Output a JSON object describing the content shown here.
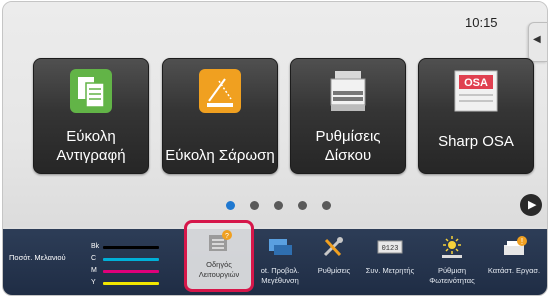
{
  "clock": "10:15",
  "tiles": [
    {
      "label": "Εύκολη Αντιγραφή",
      "icon": "copy-icon"
    },
    {
      "label": "Εύκολη Σάρωση",
      "icon": "scan-icon"
    },
    {
      "label": "Ρυθμίσεις Δίσκου",
      "icon": "tray-settings-icon"
    },
    {
      "label": "Sharp OSA",
      "icon": "sharp-osa-icon"
    }
  ],
  "pagination": {
    "count": 5,
    "active_index": 0
  },
  "taskbar": {
    "toner": {
      "title": "Ποσότ. Μελανιού",
      "rows": [
        {
          "label": "Bk",
          "color": "#000000"
        },
        {
          "label": "C",
          "color": "#00b0d8"
        },
        {
          "label": "M",
          "color": "#e0007a"
        },
        {
          "label": "Y",
          "color": "#f2e600"
        }
      ]
    },
    "items": [
      {
        "label": "Οδηγός Λειτουργιών",
        "icon": "operation-guide-icon"
      },
      {
        "label": "ot. Προβολ. Μεγέθυνση",
        "icon": "enlarge-display-icon"
      },
      {
        "label": "Ρυθμίσεις",
        "icon": "settings-tools-icon"
      },
      {
        "label": "Συν. Μετρητής",
        "icon": "counter-icon"
      },
      {
        "label": "Ρύθμιση Φωτεινότητας",
        "icon": "brightness-icon"
      },
      {
        "label": "Κατάστ. Εργασ.",
        "icon": "job-status-icon"
      }
    ]
  },
  "colors": {
    "accent": "#1f78d0",
    "highlight": "#d6174a",
    "taskbar": "#26344d"
  }
}
